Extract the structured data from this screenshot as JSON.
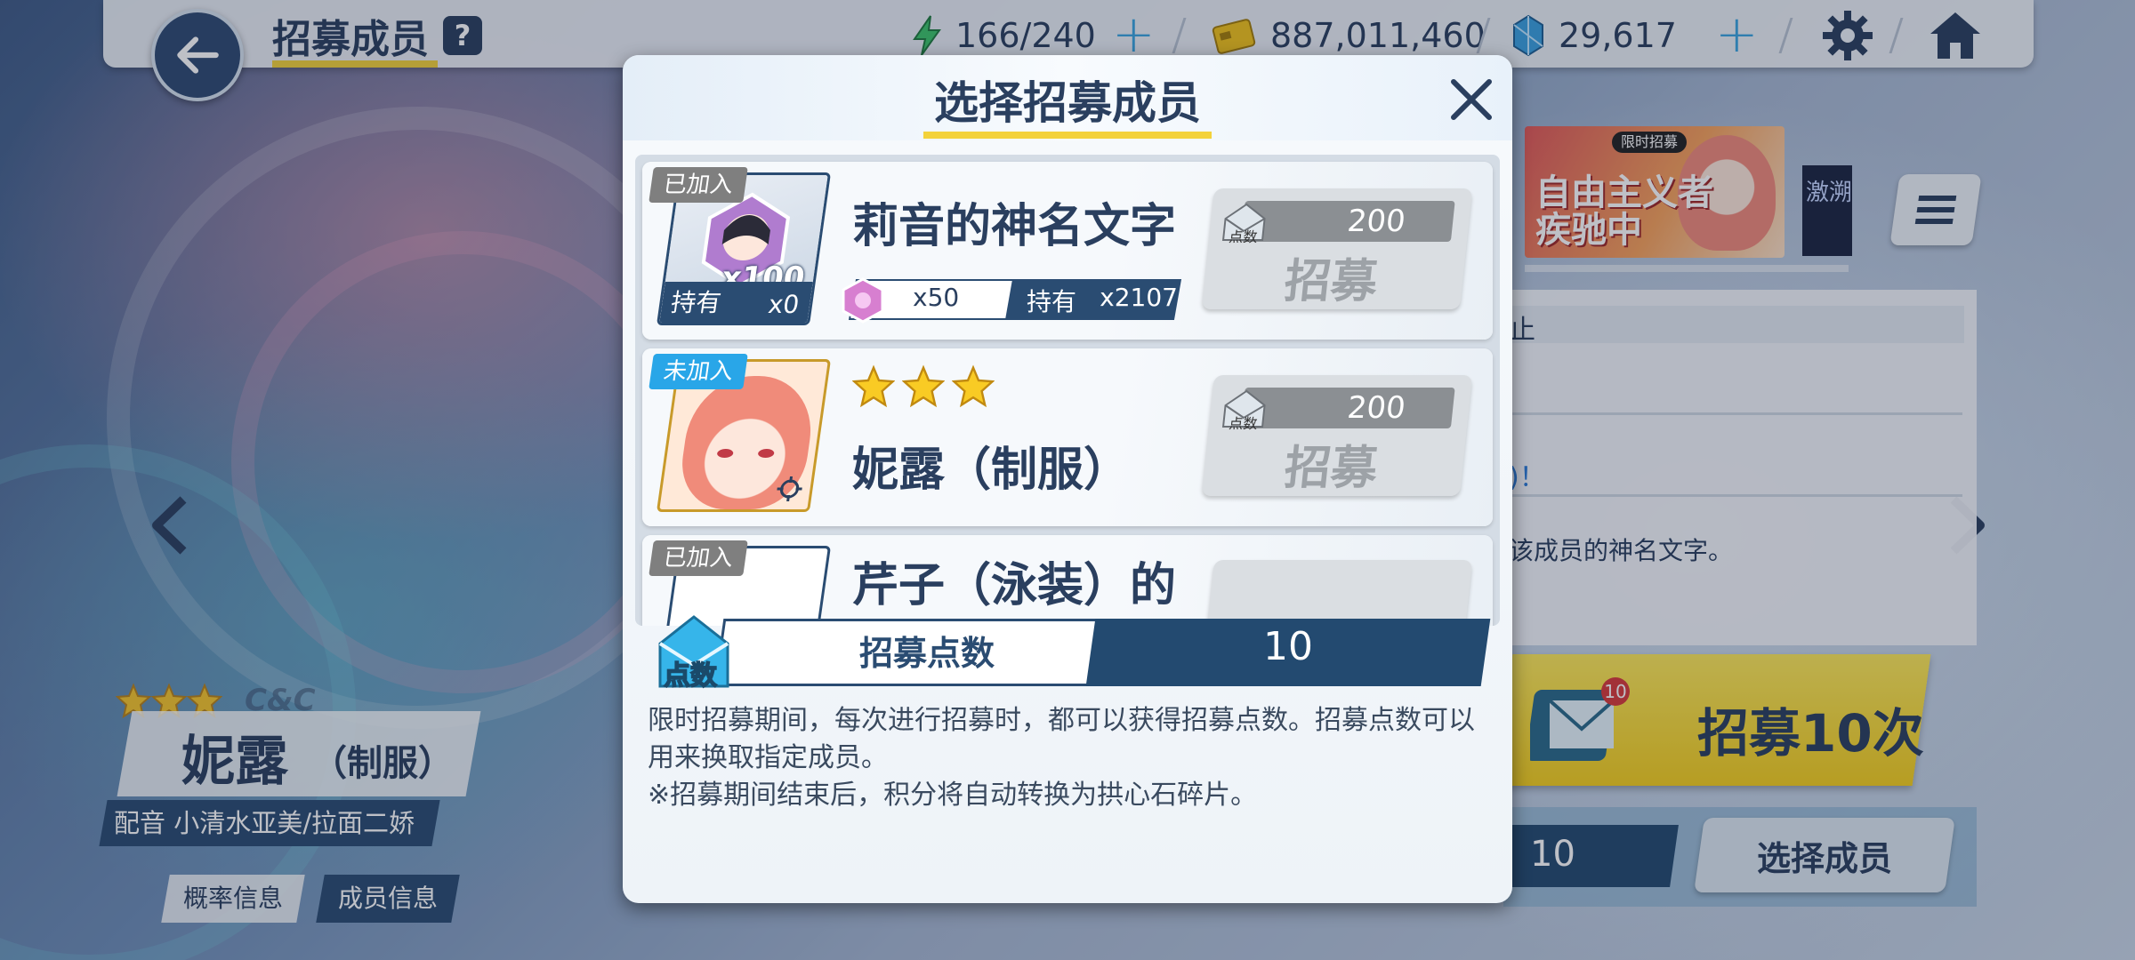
{
  "header": {
    "title": "招募成员",
    "help": "?",
    "energy": "166/240",
    "credits": "887,011,460",
    "gems": "29,617",
    "plus": "+"
  },
  "character": {
    "school": "C&C",
    "name": "妮露",
    "name_suffix": "（制服）",
    "cv": "配音 小清水亚美/拉面二娇",
    "tabs": [
      "概率信息",
      "成员信息"
    ]
  },
  "right_panel": {
    "banner_badge": "限时招募",
    "banner_text": "自由主义者\n疾驰中",
    "banner2_text": "激溯",
    "line1": "止",
    "line2": ")！",
    "line3": "该成员的神名文字。",
    "recruit10_badge": "10",
    "recruit10_label": "招募10次",
    "points_value": "10",
    "select_label": "选择成员"
  },
  "modal": {
    "title": "选择招募成员",
    "items": [
      {
        "status": "已加入",
        "title": "莉音的神名文字",
        "thumb_count": "x100",
        "own_label": "持有",
        "own_value": "x0",
        "cost_item_value": "x50",
        "hold_label": "持有",
        "hold_value": "x2107",
        "cost": "200",
        "cost_unit": "点数",
        "button": "招募"
      },
      {
        "status": "未加入",
        "title": "妮露（制服）",
        "stars": 3,
        "cost": "200",
        "cost_unit": "点数",
        "button": "招募"
      },
      {
        "status": "已加入",
        "title": "芹子（泳装）的"
      }
    ],
    "points_icon_label": "点数",
    "points_label": "招募点数",
    "points_value": "10",
    "description_1": "限时招募期间，每次进行招募时，都可以获得招募点数。招募点数可以用来换取指定成员。",
    "description_2": "※招募期间结束后，积分将自动转换为拱心石碎片。"
  },
  "colors": {
    "primary_dark": "#2a4c72",
    "accent_yellow": "#f3d23a",
    "badge_new": "#29a6e8",
    "badge_joined": "#7f7f7f"
  }
}
